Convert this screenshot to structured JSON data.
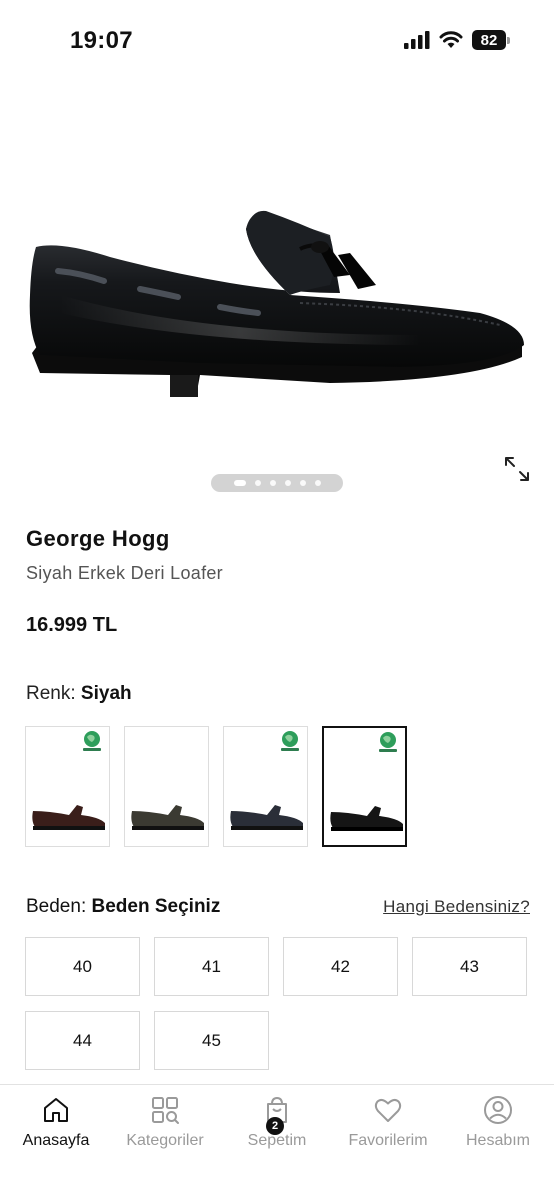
{
  "status_bar": {
    "time": "19:07",
    "battery": "82"
  },
  "product": {
    "image_icon": "black-tassel-loafer",
    "brand": "George Hogg",
    "name": "Siyah Erkek Deri Loafer",
    "price": "16.999 TL",
    "carousel": {
      "total": 6,
      "active": 1
    }
  },
  "color": {
    "label": "Renk:",
    "value": "Siyah",
    "options": [
      {
        "shoe_color": "#3a1e1a",
        "eco_badge": true,
        "selected": false
      },
      {
        "shoe_color": "#3b3a32",
        "eco_badge": false,
        "selected": false
      },
      {
        "shoe_color": "#2a2e38",
        "eco_badge": true,
        "selected": false
      },
      {
        "shoe_color": "#151515",
        "eco_badge": true,
        "selected": true
      }
    ]
  },
  "size": {
    "label": "Beden:",
    "value": "Beden Seçiniz",
    "guide_link": "Hangi Bedensiniz?",
    "options": [
      "40",
      "41",
      "42",
      "43",
      "44",
      "45"
    ]
  },
  "nav": {
    "items": [
      {
        "label": "Anasayfa",
        "icon": "home-icon",
        "active": true
      },
      {
        "label": "Kategoriler",
        "icon": "categories-icon",
        "active": false
      },
      {
        "label": "Sepetim",
        "icon": "shopping-bag-icon",
        "active": false,
        "badge": "2"
      },
      {
        "label": "Favorilerim",
        "icon": "heart-icon",
        "active": false
      },
      {
        "label": "Hesabım",
        "icon": "user-icon",
        "active": false
      }
    ]
  }
}
